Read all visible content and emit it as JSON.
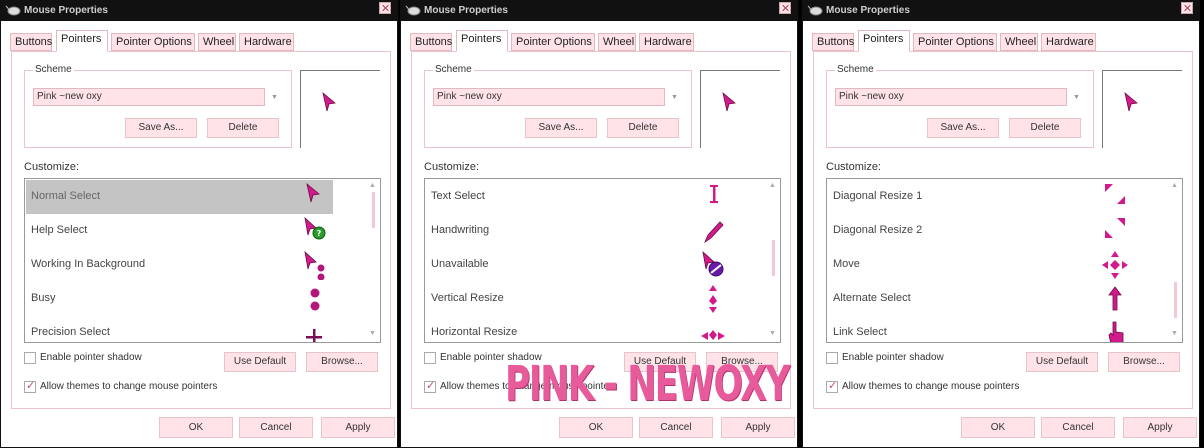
{
  "windows": [
    {
      "title": "Mouse Properties",
      "tabs": [
        "Buttons",
        "Pointers",
        "Pointer Options",
        "Wheel",
        "Hardware"
      ],
      "active_tab": "Pointers",
      "scheme_label": "Scheme",
      "scheme_value": "Pink ~new oxy",
      "save_as": "Save As...",
      "delete": "Delete",
      "customize_label": "Customize:",
      "rows": [
        {
          "label": "Normal Select",
          "icon": "normal-select-cursor-icon",
          "selected": true
        },
        {
          "label": "Help Select",
          "icon": "help-select-cursor-icon",
          "selected": false
        },
        {
          "label": "Working In Background",
          "icon": "working-background-cursor-icon",
          "selected": false
        },
        {
          "label": "Busy",
          "icon": "busy-cursor-icon",
          "selected": false
        },
        {
          "label": "Precision Select",
          "icon": "precision-select-cursor-icon",
          "selected": false
        }
      ],
      "enable_shadow": "Enable pointer shadow",
      "shadow_checked": false,
      "use_default": "Use Default",
      "browse": "Browse...",
      "allow_themes": "Allow themes to change mouse pointers",
      "allow_checked": true,
      "ok": "OK",
      "cancel": "Cancel",
      "apply": "Apply"
    },
    {
      "title": "Mouse Properties",
      "tabs": [
        "Buttons",
        "Pointers",
        "Pointer Options",
        "Wheel",
        "Hardware"
      ],
      "active_tab": "Pointers",
      "scheme_label": "Scheme",
      "scheme_value": "Pink ~new oxy",
      "save_as": "Save As...",
      "delete": "Delete",
      "customize_label": "Customize:",
      "rows": [
        {
          "label": "Text Select",
          "icon": "text-select-cursor-icon",
          "selected": false
        },
        {
          "label": "Handwriting",
          "icon": "handwriting-cursor-icon",
          "selected": false
        },
        {
          "label": "Unavailable",
          "icon": "unavailable-cursor-icon",
          "selected": false
        },
        {
          "label": "Vertical Resize",
          "icon": "vertical-resize-cursor-icon",
          "selected": false
        },
        {
          "label": "Horizontal Resize",
          "icon": "horizontal-resize-cursor-icon",
          "selected": false
        }
      ],
      "enable_shadow": "Enable pointer shadow",
      "shadow_checked": false,
      "use_default": "Use Default",
      "browse": "Browse...",
      "allow_themes": "Allow themes to change mouse pointers",
      "allow_checked": true,
      "ok": "OK",
      "cancel": "Cancel",
      "apply": "Apply"
    },
    {
      "title": "Mouse Properties",
      "tabs": [
        "Buttons",
        "Pointers",
        "Pointer Options",
        "Wheel",
        "Hardware"
      ],
      "active_tab": "Pointers",
      "scheme_label": "Scheme",
      "scheme_value": "Pink ~new oxy",
      "save_as": "Save As...",
      "delete": "Delete",
      "customize_label": "Customize:",
      "rows": [
        {
          "label": "Diagonal Resize 1",
          "icon": "diagonal-resize-1-cursor-icon",
          "selected": false
        },
        {
          "label": "Diagonal Resize 2",
          "icon": "diagonal-resize-2-cursor-icon",
          "selected": false
        },
        {
          "label": "Move",
          "icon": "move-cursor-icon",
          "selected": false
        },
        {
          "label": "Alternate Select",
          "icon": "alternate-select-cursor-icon",
          "selected": false
        },
        {
          "label": "Link Select",
          "icon": "link-select-cursor-icon",
          "selected": false
        }
      ],
      "enable_shadow": "Enable pointer shadow",
      "shadow_checked": false,
      "use_default": "Use Default",
      "browse": "Browse...",
      "allow_themes": "Allow themes to change mouse pointers",
      "allow_checked": true,
      "ok": "OK",
      "cancel": "Cancel",
      "apply": "Apply"
    }
  ],
  "watermark": "PINK - NEWOXY",
  "colors": {
    "accent": "#d21a8c",
    "button_fill": "#ffe3e8",
    "watermark": "#e75b9b"
  }
}
